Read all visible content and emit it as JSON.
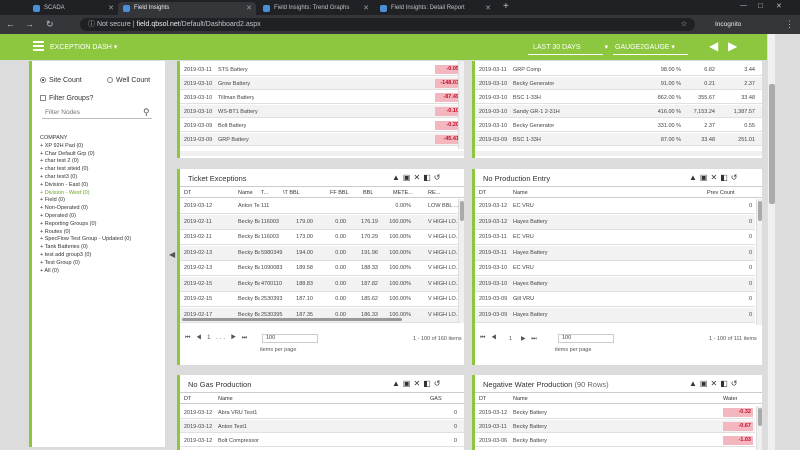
{
  "browser": {
    "tabs": [
      {
        "label": "SCADA"
      },
      {
        "label": "Field Insights"
      },
      {
        "label": "Field Insights: Trend Graphs"
      },
      {
        "label": "Field Insights: Detail Report"
      }
    ],
    "new_tab": "+",
    "url_prefix": "Not secure",
    "url_host": "field.qbsol.net",
    "url_path": "/Default/Dashboard2.aspx",
    "incognito": "Incognito",
    "window_controls": {
      "min": "—",
      "max": "□",
      "close": "✕"
    }
  },
  "appbar": {
    "menu_label": "EXCEPTION DASH",
    "date_range": "LAST 30 DAYS",
    "gauge": "GAUGE2GAUGE",
    "accent": "#8dc63f"
  },
  "left": {
    "site_count": "Site Count",
    "well_count": "Well Count",
    "filter_groups": "Filter Groups?",
    "filter_placeholder": "Filter Nodes",
    "tree": [
      {
        "label": "COMPANY",
        "root": true
      },
      {
        "label": "+ XP 92H Pad (0)"
      },
      {
        "label": "+ Char Default Grp (0)"
      },
      {
        "label": "+ char test 2 (0)"
      },
      {
        "label": "+ char test siteid (0)"
      },
      {
        "label": "+ char test3 (0)"
      },
      {
        "label": "+ Division - East (0)"
      },
      {
        "label": "+ Division - West (0)",
        "green": true
      },
      {
        "label": "+ Field (0)"
      },
      {
        "label": "+ Non-Operated (0)"
      },
      {
        "label": "+ Operated (0)"
      },
      {
        "label": "+ Reporting Groups (0)"
      },
      {
        "label": "+ Routes (0)"
      },
      {
        "label": "+ SpecFlow Test Group - Updated (0)"
      },
      {
        "label": "+ Tank Batteries (0)"
      },
      {
        "label": "+ test add group3 (0)"
      },
      {
        "label": "+ Test Group (0)"
      },
      {
        "label": "+ All (0)"
      }
    ]
  },
  "top_left": {
    "rows": [
      {
        "date": "2019-03-11",
        "name": "STS Battery",
        "val": "-0.05"
      },
      {
        "date": "2019-03-10",
        "name": "Grow Battery",
        "val": "-148.03"
      },
      {
        "date": "2019-03-10",
        "name": "Tillman Battery",
        "val": "-87.49"
      },
      {
        "date": "2019-03-10",
        "name": "WS-BT1 Battery",
        "val": "-0.10"
      },
      {
        "date": "2019-03-09",
        "name": "Bolt Battery",
        "val": "-0.20"
      },
      {
        "date": "2019-03-09",
        "name": "GRP Battery",
        "val": "-45.41"
      }
    ]
  },
  "top_right": {
    "rows": [
      {
        "date": "2019-03-11",
        "name": "GRP Comp",
        "pct": "98.00 %",
        "a": "6.82",
        "b": "3.44"
      },
      {
        "date": "2019-03-10",
        "name": "Becky Generator",
        "pct": "91.00 %",
        "a": "0.21",
        "b": "2.37"
      },
      {
        "date": "2019-03-10",
        "name": "BSC 1-33H",
        "pct": "862.00 %",
        "a": "355.67",
        "b": "33.48"
      },
      {
        "date": "2019-03-10",
        "name": "Sandy GR-1 2-31H",
        "pct": "416.00 %",
        "a": "7,153.24",
        "b": "1,387.57"
      },
      {
        "date": "2019-03-10",
        "name": "Becky Generator",
        "pct": "331.00 %",
        "a": "2.37",
        "b": "0.55"
      },
      {
        "date": "2019-03-09",
        "name": "BSC 1-33H",
        "pct": "87.00 %",
        "a": "33.48",
        "b": "251.01"
      }
    ]
  },
  "ticket": {
    "title": "Ticket Exceptions",
    "headers": [
      "DT",
      "Name",
      "T...",
      "\\T BBL",
      "FF BBL",
      "BBL",
      "METE...",
      "RE..."
    ],
    "rows": [
      [
        "2019-03-12",
        "Anton Test1",
        "111",
        "",
        "",
        "",
        "0.00%",
        "LOW BBL ..."
      ],
      [
        "2019-02-11",
        "Becky Battery",
        "116003",
        "179.00",
        "0.00",
        "176.19",
        "100.00%",
        "V HIGH LO..."
      ],
      [
        "2019-02-11",
        "Becky Battery",
        "116003",
        "173.00",
        "0.00",
        "170.29",
        "100.00%",
        "V HIGH LO..."
      ],
      [
        "2019-02-13",
        "Becky Battery",
        "5980349",
        "194.00",
        "0.00",
        "191.96",
        "100.00%",
        "V HIGH LO..."
      ],
      [
        "2019-02-13",
        "Becky Battery",
        "1090083",
        "189.58",
        "0.00",
        "188.33",
        "100.00%",
        "V HIGH LO..."
      ],
      [
        "2019-02-15",
        "Becky Battery",
        "4700110",
        "188.83",
        "0.00",
        "187.82",
        "100.00%",
        "V HIGH LO..."
      ],
      [
        "2019-02-15",
        "Becky Battery",
        "2530393",
        "187.10",
        "0.00",
        "185.62",
        "100.00%",
        "V HIGH LO..."
      ],
      [
        "2019-02-17",
        "Becky Battery",
        "2530395",
        "187.35",
        "0.00",
        "186.33",
        "100.00%",
        "V HIGH LO..."
      ]
    ],
    "per_page": "100",
    "per_page_label": "items per page",
    "range": "1 - 100 of 160 items"
  },
  "noprod": {
    "title": "No Production Entry",
    "headers": [
      "DT",
      "Name",
      "Prev Count"
    ],
    "rows": [
      [
        "2019-03-12",
        "EC VRU",
        "0"
      ],
      [
        "2019-03-12",
        "Hayes Battery",
        "0"
      ],
      [
        "2019-03-11",
        "EC VRU",
        "0"
      ],
      [
        "2019-03-11",
        "Hayes Battery",
        "0"
      ],
      [
        "2019-03-10",
        "EC VRU",
        "0"
      ],
      [
        "2019-03-10",
        "Hayes Battery",
        "0"
      ],
      [
        "2019-03-09",
        "Gill VRU",
        "0"
      ],
      [
        "2019-03-09",
        "Hayes Battery",
        "0"
      ]
    ],
    "page": "1",
    "per_page": "100",
    "per_page_label": "items per page",
    "range": "1 - 100 of 111 items"
  },
  "nogas": {
    "title": "No Gas Production",
    "headers": [
      "DT",
      "Name",
      "GAS"
    ],
    "rows": [
      [
        "2019-03-12",
        "Abra VRU Test1",
        "0"
      ],
      [
        "2019-03-12",
        "Anton Test1",
        "0"
      ],
      [
        "2019-03-12",
        "Bolt Compressor",
        "0"
      ]
    ]
  },
  "negwater": {
    "title": "Negative Water Production",
    "count": "(90 Rows)",
    "headers": [
      "DT",
      "Name",
      "Water"
    ],
    "rows": [
      [
        "2019-03-12",
        "Becky Battery",
        "-0.32"
      ],
      [
        "2019-03-11",
        "Becky Battery",
        "-0.67"
      ],
      [
        "2019-03-06",
        "Becky Battery",
        "-1.03"
      ]
    ]
  },
  "icons": {
    "panel_tools": "▲ ▣ ✕ ◧ ↺"
  }
}
